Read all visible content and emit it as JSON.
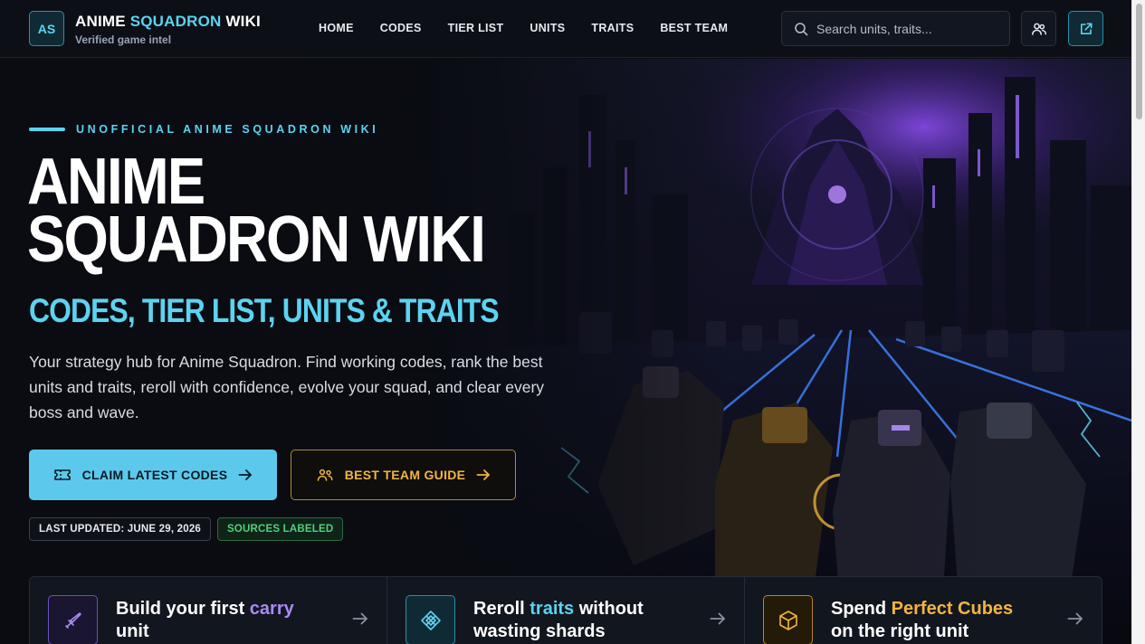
{
  "header": {
    "logo_text": "AS",
    "brand_pre": "ANIME ",
    "brand_hl": "SQUADRON",
    "brand_post": " WIKI",
    "brand_sub": "Verified game intel",
    "nav": [
      "HOME",
      "CODES",
      "TIER LIST",
      "UNITS",
      "TRAITS",
      "BEST TEAM"
    ],
    "search_placeholder": "Search units, traits...",
    "icons": [
      "search-icon",
      "users-icon",
      "external-link-icon"
    ]
  },
  "hero": {
    "eyebrow": "UNOFFICIAL ANIME SQUADRON WIKI",
    "title_line1": "ANIME",
    "title_line2": "SQUADRON WIKI",
    "subtitle": "CODES, TIER LIST, UNITS & TRAITS",
    "description": "Your strategy hub for Anime Squadron. Find working codes, rank the best units and traits, reroll with confidence, evolve your squad, and clear every boss and wave.",
    "primary_button": "CLAIM LATEST CODES",
    "secondary_button": "BEST TEAM GUIDE",
    "badge_updated": "LAST UPDATED: JUNE 29, 2026",
    "badge_sources": "SOURCES LABELED"
  },
  "cards": [
    {
      "pre": "Build your first ",
      "hl": "carry",
      "post": " unit",
      "hl_color": "#a98af5",
      "icon": "sword-icon"
    },
    {
      "pre": "Reroll ",
      "hl": "traits",
      "post": " without wasting shards",
      "hl_color": "#5cd3f0",
      "icon": "diamond-grid-icon"
    },
    {
      "pre": "Spend ",
      "hl": "Perfect Cubes",
      "post": " on the right unit",
      "hl_color": "#f3b43f",
      "icon": "cube-icon"
    }
  ],
  "colors": {
    "accent": "#5cd3f0",
    "gold": "#f3b43f",
    "purple": "#a98af5",
    "green": "#4fd17a",
    "background": "#0a0c12"
  }
}
